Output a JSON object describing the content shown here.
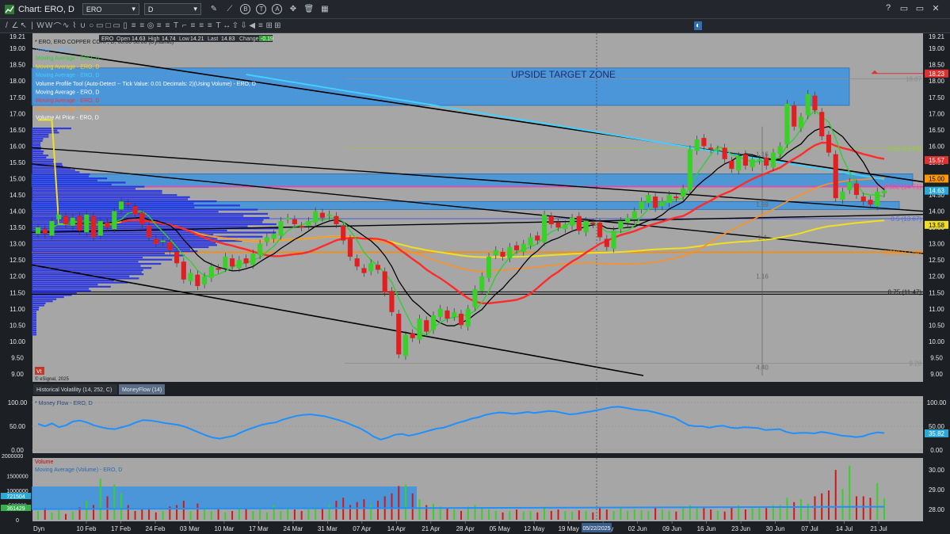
{
  "window": {
    "title": "Chart: ERO, D",
    "symbol": "ERO",
    "interval": "D",
    "toolbar_icons": [
      "pencil-icon",
      "line-icon",
      "b-circle-icon",
      "t-circle-icon",
      "a-circle-icon",
      "crosshair-icon",
      "trash-icon",
      "grid-icon"
    ],
    "controls": [
      "?",
      "▭",
      "▭",
      "✕"
    ]
  },
  "drawing_tools": [
    "/",
    "∠",
    "↖",
    "|",
    "W",
    "W",
    "⌒",
    "∿",
    "⌇",
    "∪",
    "○",
    "▭",
    "□",
    "▭",
    "▯",
    "≡",
    "≡",
    "◎",
    "≡",
    "≡",
    "T",
    "⌐",
    "≡",
    "≡",
    "≡",
    "T",
    "↔",
    "⇧",
    "⇩",
    "◀",
    "≡",
    "⊞",
    "⊞"
  ],
  "price_panel": {
    "info_header": "* ERO, ERO COPPER CORP, D, 60.00 50.00 (Dynamic)",
    "quote": {
      "symbol": "ERO",
      "open_label": "Open",
      "open": "14.63",
      "high_label": "High",
      "high": "14.74",
      "low_label": "Low",
      "low": "14.21",
      "last_label": "Last",
      "last": "14.83",
      "change_label": "Change",
      "change": "-0.19"
    },
    "top_left_value": "19.21",
    "top_right_value": "19.21",
    "legend": [
      {
        "label": "VWAP - ERO, D",
        "color": "#66b3ff"
      },
      {
        "label": "Moving Average - ERO, D",
        "color": "#32cd32"
      },
      {
        "label": "Moving Average - ERO, D",
        "color": "#f0e020"
      },
      {
        "label": "Moving Average - ERO, D",
        "color": "#42d0ff"
      },
      {
        "label": "Volume Profile Tool (Auto-Detect -- Tick Value: 0.01 Decimals: 2)(Using Volume) - ERO, D",
        "color": "#ffffff"
      },
      {
        "label": "Moving Average - ERO, D",
        "color": "#ffffff"
      },
      {
        "label": "Moving Average - ERO, D",
        "color": "#ff3030"
      },
      {
        "label": "Moving Average - ERO, D",
        "color": "#ff9020"
      },
      {
        "label": "Volume At Price - ERO, D",
        "color": "#ffffff"
      }
    ],
    "zone_label": "UPSIDE TARGET ZONE",
    "fib_labels": [
      {
        "text": "18.07",
        "price": 18.07,
        "color": "#888888"
      },
      {
        "text": "0.25 (15.82)",
        "price": 15.92,
        "color": "#9acd32"
      },
      {
        "text": "0.382 (14.71)",
        "price": 14.75,
        "color": "#ff3ea5"
      },
      {
        "text": "0.5 (13.67)",
        "price": 13.77,
        "color": "#5a6dd6"
      },
      {
        "text": "0.618 (12.64)",
        "price": 12.74,
        "color": "#ff8c00"
      },
      {
        "text": "0.75 (11.47)",
        "price": 11.52,
        "color": "#1a1a1a"
      },
      {
        "text": "9.28",
        "price": 9.33,
        "color": "#888888"
      }
    ],
    "small_labels": [
      {
        "text": "1.16",
        "price": 15.75
      },
      {
        "text": "1.69",
        "price": 14.21
      },
      {
        "text": "1.4",
        "price": 13.2
      },
      {
        "text": "1.16",
        "price": 12.0
      },
      {
        "text": "4.40",
        "price": 9.2
      }
    ],
    "esignal_note": "© eSignal, 2025",
    "esignal_logo": "Vt",
    "price_tags": [
      {
        "text": "18.23",
        "price": 18.23,
        "bg": "#e03030",
        "fg": "#ffffff"
      },
      {
        "text": "15.57",
        "price": 15.57,
        "bg": "#e03030",
        "fg": "#ffffff"
      },
      {
        "text": "15.00",
        "price": 15.0,
        "bg": "#ff9900",
        "fg": "#000000"
      },
      {
        "text": "14.63",
        "price": 14.63,
        "bg": "#2aa8d8",
        "fg": "#ffffff"
      },
      {
        "text": "13.58",
        "price": 13.58,
        "bg": "#f0e020",
        "fg": "#000000"
      }
    ]
  },
  "indicator_tabs": [
    "Historical Volatility (14, 252, C)",
    "MoneyFlow (14)"
  ],
  "moneyflow_panel": {
    "legend": "* Money Flow - ERO, D",
    "tag": "35.82"
  },
  "volume_panel": {
    "legend": [
      "Volume",
      "Moving Average (Volume) - ERO, D"
    ],
    "left_tags": [
      "721504",
      "361429"
    ],
    "top_left_value": "2000000"
  },
  "x_axis": {
    "corner": "Dyn",
    "cursor_label": "05/22/2025"
  },
  "chart_data": [
    {
      "type": "candlestick",
      "title": "ERO, D",
      "y_axis_ticks": [
        9.0,
        9.5,
        10.0,
        10.5,
        11.0,
        11.5,
        12.0,
        12.5,
        13.0,
        13.5,
        14.0,
        14.5,
        15.0,
        15.5,
        16.0,
        16.5,
        17.0,
        17.5,
        18.0,
        18.5,
        19.0
      ],
      "ylim": [
        8.95,
        19.15
      ],
      "x_ticks": [
        "10 Feb",
        "17 Feb",
        "24 Feb",
        "03 Mar",
        "10 Mar",
        "17 Mar",
        "24 Mar",
        "31 Mar",
        "07 Apr",
        "14 Apr",
        "21 Apr",
        "28 Apr",
        "05 May",
        "12 May",
        "19 May",
        "26 May",
        "02 Jun",
        "09 Jun",
        "16 Jun",
        "23 Jun",
        "30 Jun",
        "07 Jul",
        "14 Jul",
        "21 Jul"
      ],
      "close": [
        13.5,
        13.3,
        13.7,
        13.9,
        13.6,
        13.8,
        13.4,
        13.9,
        13.2,
        13.7,
        13.5,
        14.0,
        14.3,
        14.2,
        13.9,
        13.6,
        13.2,
        13.0,
        13.1,
        12.8,
        12.4,
        11.9,
        12.1,
        11.7,
        12.0,
        12.3,
        12.2,
        12.6,
        12.3,
        12.5,
        12.4,
        12.7,
        13.0,
        13.2,
        13.3,
        13.7,
        13.8,
        13.6,
        13.5,
        13.7,
        14.0,
        13.8,
        13.9,
        13.6,
        13.1,
        12.6,
        12.3,
        12.1,
        12.4,
        12.2,
        11.5,
        10.9,
        9.6,
        10.2,
        10.1,
        10.7,
        10.3,
        10.8,
        11.0,
        10.7,
        10.9,
        10.5,
        11.0,
        11.6,
        12.0,
        12.6,
        12.8,
        12.6,
        12.9,
        12.8,
        13.0,
        13.2,
        13.1,
        13.9,
        13.6,
        13.5,
        13.6,
        13.8,
        13.4,
        13.7,
        13.6,
        13.2,
        12.9,
        13.4,
        13.7,
        13.8,
        14.0,
        14.3,
        14.5,
        14.1,
        14.3,
        14.5,
        14.4,
        14.7,
        15.9,
        16.2,
        16.0,
        15.9,
        15.9,
        15.6,
        15.3,
        15.7,
        15.4,
        15.6,
        15.6,
        15.4,
        15.8,
        16.0,
        17.3,
        16.6,
        16.9,
        17.6,
        17.1,
        16.3,
        15.8,
        14.4,
        14.6,
        14.9,
        14.5,
        14.3,
        14.2,
        14.6,
        14.63
      ],
      "levels": {
        "fib_1.0": 18.07,
        "fib_0.25": 15.82,
        "fib_0.382": 14.71,
        "fib_0.5": 13.67,
        "fib_0.618": 12.64,
        "fib_0.75": 11.47,
        "fib_0.0": 9.28
      },
      "zones": [
        {
          "label": "UPSIDE TARGET ZONE",
          "from": 17.25,
          "to": 18.4
        },
        {
          "label": "",
          "from": 14.75,
          "to": 15.15
        },
        {
          "label": "",
          "from": 14.05,
          "to": 14.3
        }
      ],
      "grid": false
    },
    {
      "type": "line",
      "title": "Money Flow - ERO, D",
      "y_axis_ticks": [
        0.0,
        50.0,
        100.0
      ],
      "ylim": [
        0,
        100
      ],
      "values": [
        55,
        50,
        56,
        48,
        52,
        60,
        62,
        58,
        52,
        48,
        45,
        44,
        48,
        52,
        58,
        63,
        62,
        60,
        57,
        55,
        53,
        49,
        43,
        37,
        31,
        26,
        24,
        27,
        30,
        37,
        43,
        48,
        53,
        56,
        58,
        64,
        68,
        72,
        74,
        75,
        73,
        71,
        67,
        63,
        58,
        52,
        46,
        38,
        28,
        22,
        26,
        32,
        34,
        30,
        33,
        37,
        41,
        45,
        47,
        52,
        57,
        61,
        66,
        69,
        74,
        77,
        79,
        78,
        76,
        78,
        80,
        78,
        80,
        82,
        81,
        78,
        75,
        76,
        79,
        81,
        84,
        87,
        90,
        91,
        89,
        86,
        84,
        83,
        80,
        76,
        72,
        68,
        60,
        52,
        50,
        50,
        47,
        50,
        51,
        47,
        46,
        48,
        47,
        46,
        42,
        43,
        44,
        38,
        35,
        36,
        36,
        35,
        38,
        36,
        33,
        30,
        29,
        27,
        29,
        34,
        37,
        35.82
      ]
    },
    {
      "type": "bar",
      "title": "Volume",
      "y_axis_ticks_left": [
        0,
        500000,
        1000000,
        1500000,
        2000000
      ],
      "y_axis_ticks_right": [
        28.0,
        29.0,
        30.0
      ],
      "ylim": [
        0,
        2000000
      ],
      "values": [
        300000,
        400000,
        250000,
        350000,
        200000,
        280000,
        420000,
        650000,
        500000,
        1400000,
        800000,
        1200000,
        900000,
        500000,
        300000,
        350000,
        400000,
        250000,
        300000,
        450000,
        500000,
        650000,
        300000,
        550000,
        400000,
        300000,
        350000,
        250000,
        300000,
        450000,
        400000,
        300000,
        350000,
        250000,
        500000,
        300000,
        400000,
        350000,
        300000,
        350000,
        450000,
        400000,
        500000,
        650000,
        750000,
        500000,
        600000,
        700000,
        500000,
        650000,
        800000,
        900000,
        1150000,
        1200000,
        900000,
        700000,
        500000,
        550000,
        450000,
        400000,
        350000,
        300000,
        450000,
        500000,
        400000,
        350000,
        300000,
        250000,
        300000,
        350000,
        280000,
        300000,
        250000,
        400000,
        300000,
        350000,
        300000,
        280000,
        320000,
        300000,
        250000,
        400000,
        350000,
        300000,
        420000,
        300000,
        350000,
        320000,
        300000,
        400000,
        350000,
        300000,
        280000,
        400000,
        500000,
        450000,
        400000,
        350000,
        300000,
        280000,
        420000,
        500000,
        350000,
        400000,
        450000,
        400000,
        500000,
        500000,
        750000,
        600000,
        700000,
        550000,
        800000,
        900000,
        1000000,
        1700000,
        1050000,
        1850000,
        800000,
        800000,
        750000,
        1250000,
        721504
      ],
      "moving_average": 361429
    }
  ]
}
